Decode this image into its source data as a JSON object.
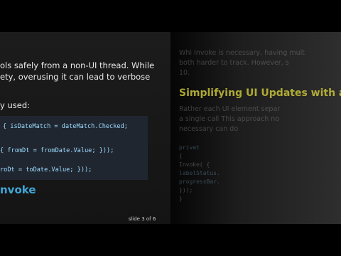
{
  "left_slide": {
    "paragraph": [
      "ols safely from a non-UI thread. While",
      "ety, overusing it can lead to verbose"
    ],
    "intro_line": "y used:",
    "code_lines": [
      "{ isDateMatch = dateMatch.Checked;",
      "{ fromDt = fromDate.Value; }));",
      "roDt = toDate.Value; }));"
    ],
    "heading": "nvoke",
    "slide_counter": "slide 3 of 6"
  },
  "right_slide": {
    "paragraph": [
      "Whi      Invoke is necessary, having mult",
      "both          harder to track. However, s",
      "10."
    ],
    "heading": "Simplifying UI Updates with a Sing",
    "paragraph2": [
      "Rather                  each UI element separ",
      "a single       call          This approach no",
      "necessary                                     can do"
    ],
    "code_lines": [
      "privat                                                          ",
      "{",
      "    Invoke(                      {",
      "        labelStatus.                 ",
      "        progressBar.                 ",
      "    }));",
      "}"
    ]
  },
  "colors": {
    "heading_blue": "#3ea6d8",
    "heading_yellow": "#c9c33a",
    "code_var": "#9cdcfe",
    "code_text": "#dcdcdc"
  }
}
